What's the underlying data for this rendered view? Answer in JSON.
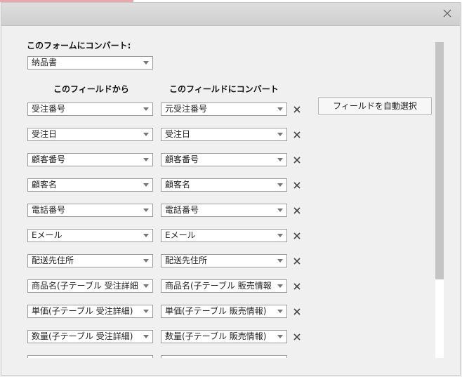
{
  "dialog": {
    "close_icon": "close-icon"
  },
  "target_form": {
    "label": "このフォームにコンバート:",
    "selected": "納品書"
  },
  "columns": {
    "from": "このフィールドから",
    "to": "このフィールドにコンバート"
  },
  "auto_select_label": "フィールドを自動選択",
  "rows": [
    {
      "from": "受注番号",
      "to": "元受注番号"
    },
    {
      "from": "受注日",
      "to": "受注日"
    },
    {
      "from": "顧客番号",
      "to": "顧客番号"
    },
    {
      "from": "顧客名",
      "to": "顧客名"
    },
    {
      "from": "電話番号",
      "to": "電話番号"
    },
    {
      "from": "Eメール",
      "to": "Eメール"
    },
    {
      "from": "配送先住所",
      "to": "配送先住所"
    },
    {
      "from": "商品名(子テーブル 受注詳細)",
      "to": "商品名(子テーブル 販売情報)"
    },
    {
      "from": "単価(子テーブル 受注詳細)",
      "to": "単価(子テーブル 販売情報)"
    },
    {
      "from": "数量(子テーブル 受注詳細)",
      "to": "数量(子テーブル 販売情報)"
    },
    {
      "from": "",
      "to": ""
    }
  ]
}
